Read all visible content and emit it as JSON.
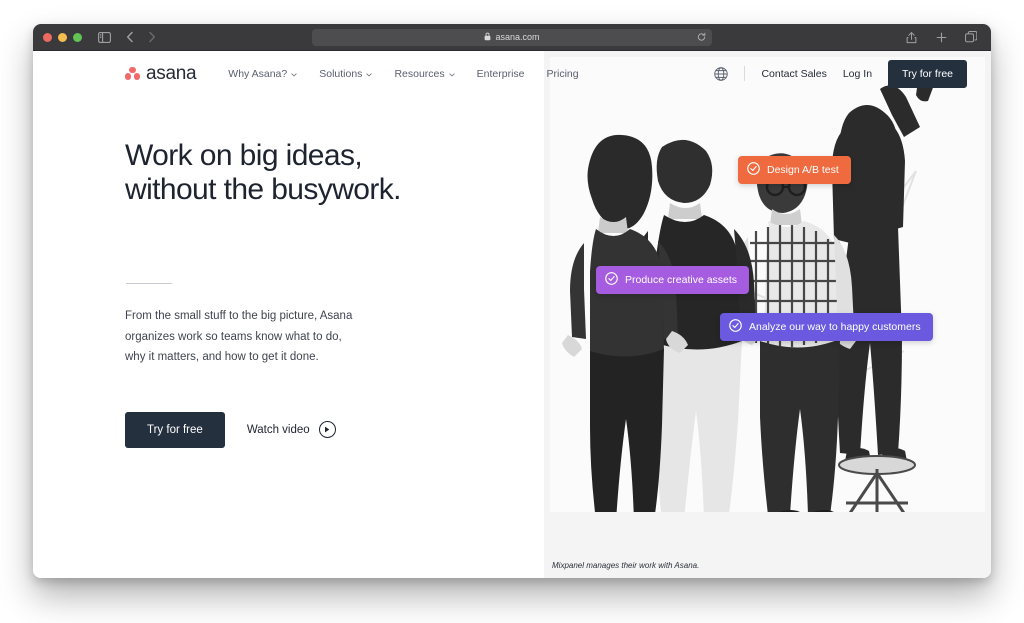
{
  "browser": {
    "traffic_lights": [
      "close",
      "minimize",
      "maximize"
    ],
    "sidebar_icon": "sidebar-icon",
    "back_icon": "chevron-left-icon",
    "forward_icon": "chevron-right-icon",
    "shade_icon": "contrast-icon",
    "lock_icon": "lock-icon",
    "url": "asana.com",
    "reload_icon": "reload-icon",
    "share_icon": "share-icon",
    "new_tab_icon": "plus-icon",
    "tab_overview_icon": "tabs-icon"
  },
  "nav": {
    "logo_text": "asana",
    "links": [
      {
        "label": "Why Asana?",
        "has_caret": true
      },
      {
        "label": "Solutions",
        "has_caret": true
      },
      {
        "label": "Resources",
        "has_caret": true
      },
      {
        "label": "Enterprise",
        "has_caret": false
      },
      {
        "label": "Pricing",
        "has_caret": false
      }
    ],
    "globe_icon": "globe-icon",
    "contact_sales": "Contact Sales",
    "log_in": "Log In",
    "try_free": "Try for free"
  },
  "hero": {
    "headline": "Work on big ideas,\nwithout the busywork.",
    "subcopy": "From the small stuff to the big picture, Asana\norganizes work so teams know what to do,\nwhy it matters, and how to get it done.",
    "cta_primary": "Try for free",
    "watch_video": "Watch video",
    "caption": "Mixpanel manages their work with Asana."
  },
  "badges": [
    {
      "label": "Design A/B test",
      "color": "#f06a3f",
      "icon": "check-circle-icon"
    },
    {
      "label": "Produce creative assets",
      "color": "#a55ce0",
      "icon": "check-circle-icon"
    },
    {
      "label": "Analyze our way to happy customers",
      "color": "#6b5ae0",
      "icon": "check-circle-icon"
    }
  ],
  "colors": {
    "brand_coral": "#f06a6a",
    "dark_navy": "#25303f",
    "hero_bg": "#f4f4f4"
  }
}
